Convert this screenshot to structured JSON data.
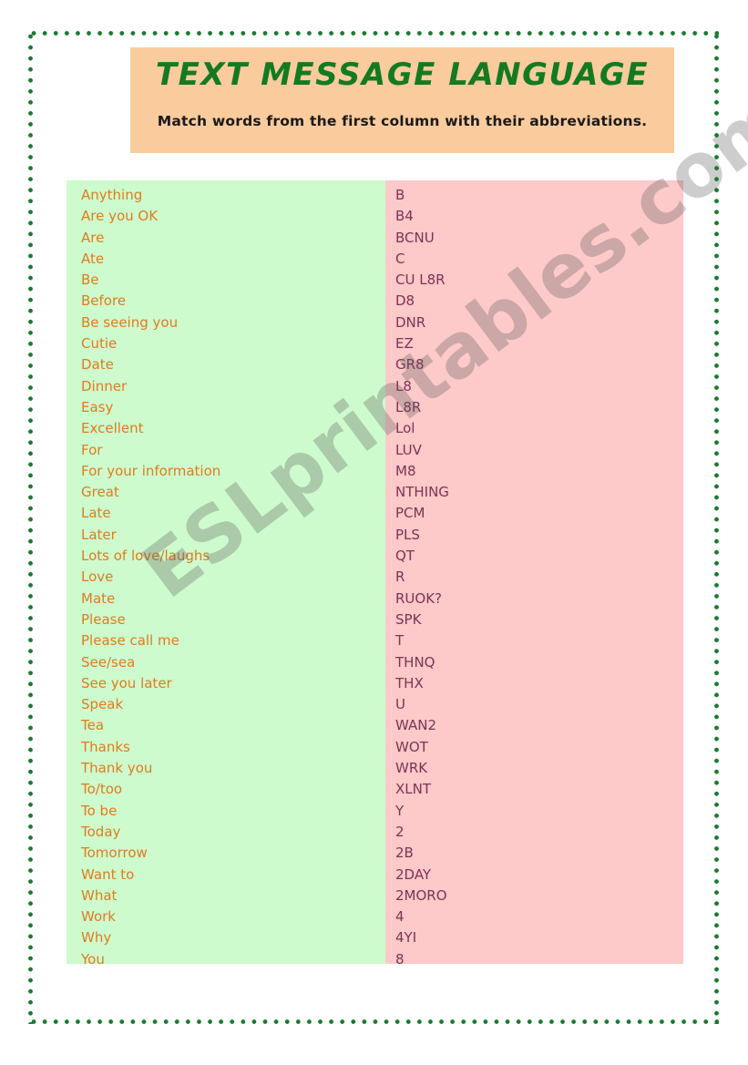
{
  "header": {
    "title": "TEXT MESSAGE LANGUAGE",
    "subtitle": "Match words from the first column with their abbreviations.",
    "background_color": "#facb9d",
    "title_color": "#147a22",
    "subtitle_color": "#1a1a1a"
  },
  "table": {
    "words_column": {
      "background_color": "#cdfbcd",
      "text_color": "#e07b1e",
      "items": [
        "Anything",
        "Are you OK",
        "Are",
        "Ate",
        "Be",
        "Before",
        "Be seeing you",
        "Cutie",
        "Date",
        "Dinner",
        "Easy",
        "Excellent",
        "For",
        "For your information",
        "Great",
        "Late",
        "Later",
        "Lots of love/laughs",
        "Love",
        "Mate",
        "Please",
        "Please call me",
        "See/sea",
        "See you later",
        "Speak",
        "Tea",
        "Thanks",
        "Thank you",
        "To/too",
        "To be",
        "Today",
        "Tomorrow",
        "Want to",
        "What",
        "Work",
        "Why",
        "You"
      ]
    },
    "abbreviations_column": {
      "background_color": "#fdc9c9",
      "text_color": "#7d3455",
      "items": [
        "B",
        "B4",
        "BCNU",
        "C",
        "CU L8R",
        "D8",
        "DNR",
        "EZ",
        "GR8",
        "L8",
        "L8R",
        "Lol",
        "LUV",
        "M8",
        "NTHING",
        "PCM",
        "PLS",
        "QT",
        "R",
        "RUOK?",
        "SPK",
        "T",
        "THNQ",
        "THX",
        "U",
        "WAN2",
        "WOT",
        "WRK",
        "XLNT",
        "Y",
        "2",
        "2B",
        "2DAY",
        "2MORO",
        "4",
        "4YI",
        "8"
      ]
    }
  },
  "watermark": {
    "text": "ESLprintables.com"
  },
  "border": {
    "color": "#1a7a2e",
    "style": "dotted"
  }
}
